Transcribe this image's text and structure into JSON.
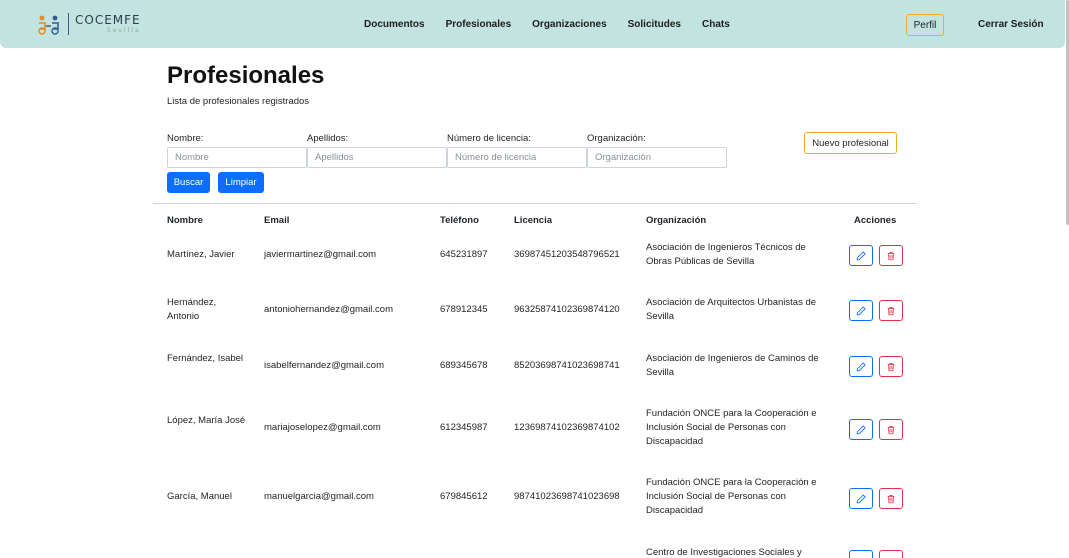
{
  "brand": {
    "title": "COCEMFE",
    "subtitle": "Sevilla"
  },
  "nav": {
    "items": [
      "Documentos",
      "Profesionales",
      "Organizaciones",
      "Solicitudes",
      "Chats"
    ],
    "perfil": "Perfil",
    "logout": "Cerrar Sesión"
  },
  "page": {
    "title": "Profesionales",
    "subtitle": "Lista de profesionales registrados"
  },
  "filters": {
    "nombre": {
      "label": "Nombre:",
      "placeholder": "Nombre",
      "value": ""
    },
    "apellidos": {
      "label": "Apellidos:",
      "placeholder": "Apellidos",
      "value": ""
    },
    "licencia": {
      "label": "Número de licencia:",
      "placeholder": "Número de licencia",
      "value": ""
    },
    "organizacion": {
      "label": "Organización:",
      "placeholder": "Organización",
      "value": ""
    },
    "search_label": "Buscar",
    "clear_label": "Limpiar",
    "new_label": "Nuevo profesional"
  },
  "table": {
    "headers": [
      "Nombre",
      "Email",
      "Teléfono",
      "Licencia",
      "Organización",
      "Acciones"
    ],
    "rows": [
      {
        "nombre": "Martínez, Javier",
        "email": "javiermartinez@gmail.com",
        "telefono": "645231897",
        "licencia": "36987451203548796521",
        "organizacion": "Asociación de Ingenieros Técnicos de Obras Públicas de Sevilla"
      },
      {
        "nombre": "Hernández, Antonio",
        "email": "antoniohernandez@gmail.com",
        "telefono": "678912345",
        "licencia": "96325874102369874120",
        "organizacion": "Asociación de Arquitectos Urbanistas de Sevilla"
      },
      {
        "nombre": "Fernández, Isabel",
        "email": "isabelfernandez@gmail.com",
        "telefono": "689345678",
        "licencia": "85203698741023698741",
        "organizacion": "Asociación de Ingenieros de Caminos de Sevilla"
      },
      {
        "nombre": "López, María José",
        "email": "mariajoselopez@gmail.com",
        "telefono": "612345987",
        "licencia": "12369874102369874102",
        "organizacion": "Fundación ONCE para la Cooperación e Inclusión Social de Personas con Discapacidad"
      },
      {
        "nombre": "García, Manuel",
        "email": "manuelgarcia@gmail.com",
        "telefono": "679845612",
        "licencia": "98741023698741023698",
        "organizacion": "Fundación ONCE para la Cooperación e Inclusión Social de Personas con Discapacidad"
      },
      {
        "nombre": "",
        "email": "",
        "telefono": "",
        "licencia": "",
        "organizacion": "Centro de Investigaciones Sociales y"
      }
    ]
  },
  "icons": {
    "edit": "pencil-icon",
    "delete": "trash-icon"
  },
  "colors": {
    "navbar": "#c2e3df",
    "primary": "#0d6efd",
    "warning": "#f0ad1f",
    "danger": "#dc3545"
  }
}
